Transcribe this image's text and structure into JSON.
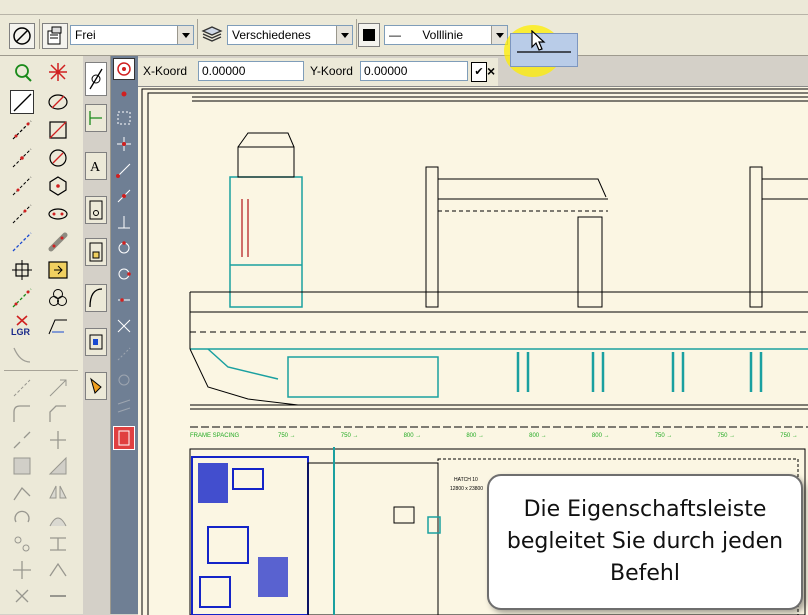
{
  "toolbar": {
    "layer_value": "Frei",
    "category_value": "Verschiedenes",
    "linetype_value": "Volllinie",
    "linetype_preview": "—"
  },
  "property_bar": {
    "x_label": "X-Koord",
    "x_value": "0.00000",
    "y_label": "Y-Koord",
    "y_value": "0.00000",
    "confirm_symbol": "✔",
    "cancel_symbol": "×"
  },
  "drawing": {
    "frame_spacing_label": "FRAME SPACING",
    "hatch_label": "HATCH 10",
    "hatch_dims": "12800 x 23800",
    "spacing_labels": [
      "750 →",
      "750 →",
      "800 →",
      "800 →",
      "800 →",
      "800 →",
      "750 →",
      "750 →",
      "750 →"
    ]
  },
  "tools": {
    "lgr_label": "LGR"
  },
  "callout": {
    "text": "Die Eigenschaftsleiste begleitet Sie durch jeden Befehl"
  },
  "colors": {
    "toolbar_bg": "#ece9d8",
    "canvas_bg": "#fbf6e3",
    "drawing_line": "#000000",
    "teal_line": "#1aa0a0",
    "blue_fill": "#1424c8",
    "green_text": "#22aa22",
    "highlight": "#ffee00"
  }
}
